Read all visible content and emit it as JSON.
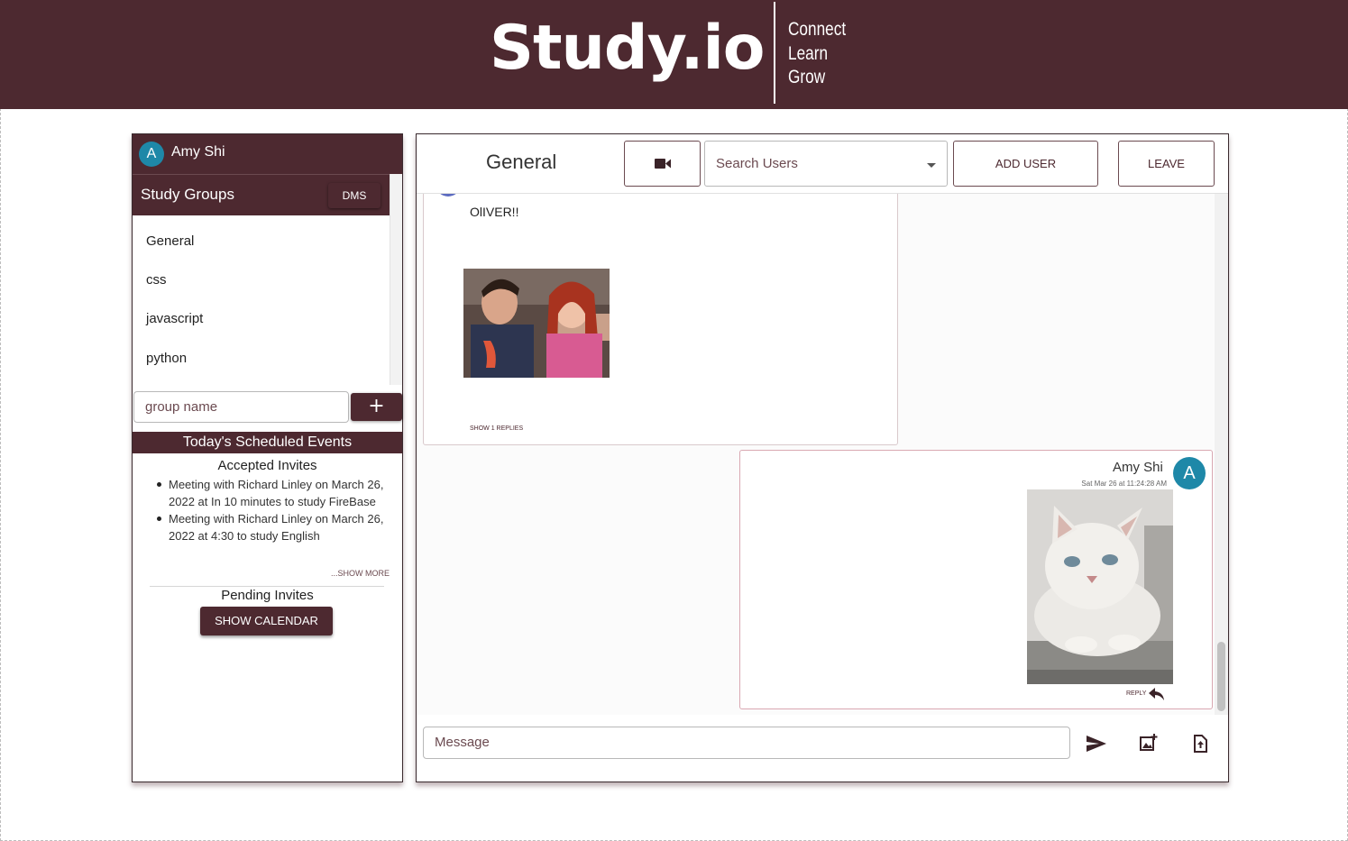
{
  "header": {
    "logo": "Study.io",
    "tagline": [
      "Connect",
      "Learn",
      "Grow"
    ]
  },
  "sidebar": {
    "user": {
      "avatar_letter": "A",
      "name": "Amy Shi"
    },
    "groups_title": "Study Groups",
    "dms_label": "DMS",
    "groups": [
      "General",
      "css",
      "javascript",
      "python"
    ],
    "group_input_placeholder": "group name",
    "add_group_label": "+",
    "events_title": "Today's Scheduled Events",
    "accepted_title": "Accepted Invites",
    "accepted_events": [
      "Meeting with Richard Linley on March 26, 2022 at In 10 minutes to study FireBase",
      "Meeting with Richard Linley on March 26, 2022 at 4:30 to study English"
    ],
    "show_more": "...SHOW MORE",
    "pending_title": "Pending Invites",
    "calendar_button": "SHOW CALENDAR"
  },
  "chat": {
    "channel_title": "General",
    "search_placeholder": "Search Users",
    "add_user_label": "ADD USER",
    "leave_label": "LEAVE",
    "messages": [
      {
        "text": "OlIVER!!",
        "show_replies": "SHOW 1 REPLIES"
      },
      {
        "author": "Amy Shi",
        "avatar_letter": "A",
        "time": "Sat Mar 26 at 11:24:28 AM",
        "reply": "REPLY"
      }
    ],
    "message_placeholder": "Message"
  },
  "colors": {
    "brand": "#4d2930",
    "avatar": "#1e88a8"
  }
}
